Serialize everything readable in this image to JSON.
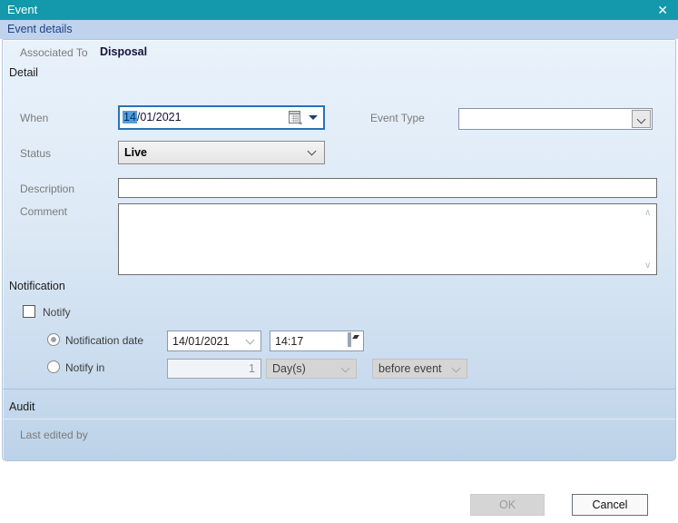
{
  "window": {
    "title": "Event",
    "close_glyph": "✕"
  },
  "header": {
    "label": "Event details"
  },
  "associated": {
    "label": "Associated To",
    "value": "Disposal"
  },
  "sections": {
    "detail": "Detail",
    "notification": "Notification",
    "audit": "Audit"
  },
  "fields": {
    "when": {
      "label": "When",
      "day_selected": "14",
      "date_rest": "/01/2021"
    },
    "event_type": {
      "label": "Event Type",
      "value": ""
    },
    "status": {
      "label": "Status",
      "value": "Live"
    },
    "description": {
      "label": "Description",
      "value": ""
    },
    "comment": {
      "label": "Comment",
      "value": ""
    }
  },
  "notification": {
    "notify_label": "Notify",
    "notify_checked": false,
    "notification_date": {
      "label": "Notification date",
      "date": "14/01/2021",
      "time": "14:17",
      "selected": true
    },
    "notify_in": {
      "label": "Notify in",
      "value": "1",
      "unit": "Day(s)",
      "relation": "before event",
      "selected": false
    }
  },
  "audit": {
    "last_edited_label": "Last edited by",
    "value": ""
  },
  "buttons": {
    "ok": "OK",
    "cancel": "Cancel"
  },
  "scroll": {
    "up": "∧",
    "down": "∨"
  },
  "colors": {
    "titlebar": "#1399ab",
    "header_bar": "#bfd3ec",
    "header_text": "#22418a",
    "focus_border": "#2a72b5",
    "selection_highlight": "#4f9fe0",
    "panel_top": "#e9f2fb",
    "panel_bottom": "#bcd2e8"
  }
}
